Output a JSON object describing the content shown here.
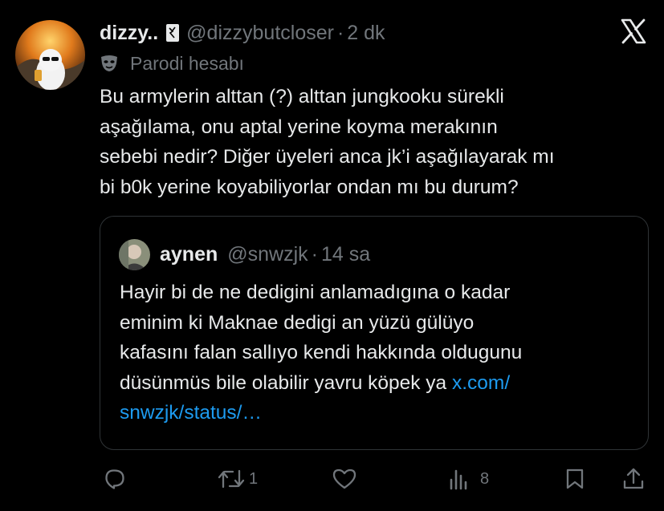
{
  "author": {
    "display_name": "dizzy..",
    "handle": "@dizzybutcloser",
    "time": "2 dk",
    "parody_label": "Parodi hesabı"
  },
  "tweet": {
    "lines": [
      "Bu armylerin alttan (?) alttan jungkooku sürekli",
      "aşağılama, onu aptal yerine koyma merakının",
      "sebebi nedir? Diğer üyeleri anca jk’i aşağılayarak mı",
      "bi b0k yerine koyabiliyorlar ondan mı bu durum?"
    ]
  },
  "quote": {
    "display_name": "aynen",
    "handle": "@snwzjk",
    "time": "14 sa",
    "lines": [
      "Hayir bi de ne dedigini anlamadıgına o kadar",
      "eminim ki Maknae dedigi an yüzü gülüyo",
      "kafasını falan sallıyo kendi hakkında oldugunu"
    ],
    "line4_text": "düsünmüs bile olabilir yavru köpek ya ",
    "line4_link": "x.com/",
    "line5_link": "snwzjk/status/…"
  },
  "separator": "·",
  "actions": {
    "reply_icon": "reply-icon",
    "retweet_icon": "retweet-icon",
    "retweet_count": "1",
    "like_icon": "heart-icon",
    "views_icon": "views-icon",
    "views_count": "8",
    "bookmark_icon": "bookmark-icon",
    "share_icon": "share-icon"
  },
  "colors": {
    "background": "#000000",
    "text": "#e7e9ea",
    "muted": "#71767b",
    "link": "#1d9bf0",
    "border": "#2f3336"
  }
}
